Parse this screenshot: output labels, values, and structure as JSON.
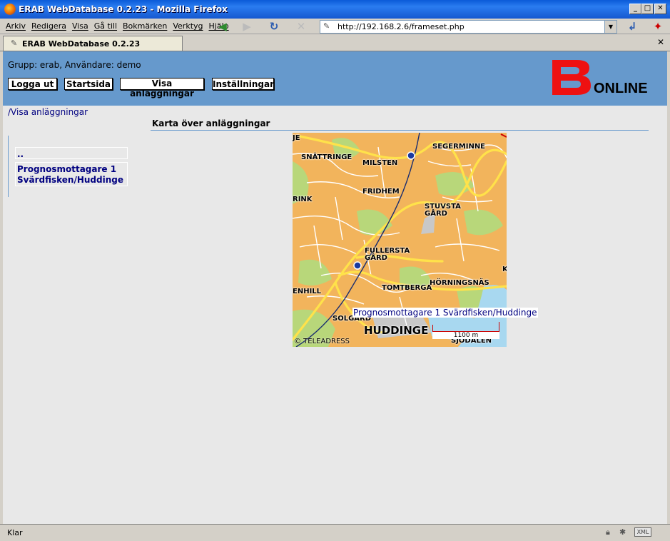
{
  "window": {
    "title": "ERAB WebDatabase 0.2.23 - Mozilla Firefox",
    "icons": [
      "firefox-icon",
      "minimize-icon",
      "maximize-icon",
      "close-icon"
    ]
  },
  "menu": {
    "items": [
      "Arkiv",
      "Redigera",
      "Visa",
      "Gå till",
      "Bokmärken",
      "Verktyg",
      "Hjälp"
    ]
  },
  "nav": {
    "url": "http://192.168.2.6/frameset.php"
  },
  "tab": {
    "label": "ERAB WebDatabase 0.2.23"
  },
  "header": {
    "group_text": "Grupp: erab, Användare: demo",
    "buttons": [
      "Logga ut",
      "Startsida",
      "Visa anläggningar",
      "Inställningar"
    ],
    "logo_text": "ONLINE",
    "logo_color": "#ee1111",
    "background_color": "#6699cc"
  },
  "breadcrumb": "/Visa anläggningar",
  "sidebar": {
    "items": [
      "..",
      "Prognosmottagare 1 Svärdfisken/Huddinge"
    ]
  },
  "main": {
    "section_title": "Karta över anläggningar",
    "map": {
      "labels": [
        "JE",
        "SNÄTTRINGE",
        "SEGERMINNE",
        "MILSTEN",
        "FRIDHEM",
        "RINK",
        "STUVSTA",
        "GÅRD",
        "FULLERSTA",
        "GÅRD",
        "K",
        "ENHILL",
        "TOMTBERGA",
        "HÖRNINGSNÄS",
        "SOLGÅRD",
        "HUDDINGE",
        "SJÖDALEN"
      ],
      "copyright": "© TELEADRESS",
      "scale": "1100 m",
      "facility_label": "Prognosmottagare 1 Svärdfisken/Huddinge"
    }
  },
  "status": {
    "text": "Klar",
    "xml_badge": "XML"
  }
}
